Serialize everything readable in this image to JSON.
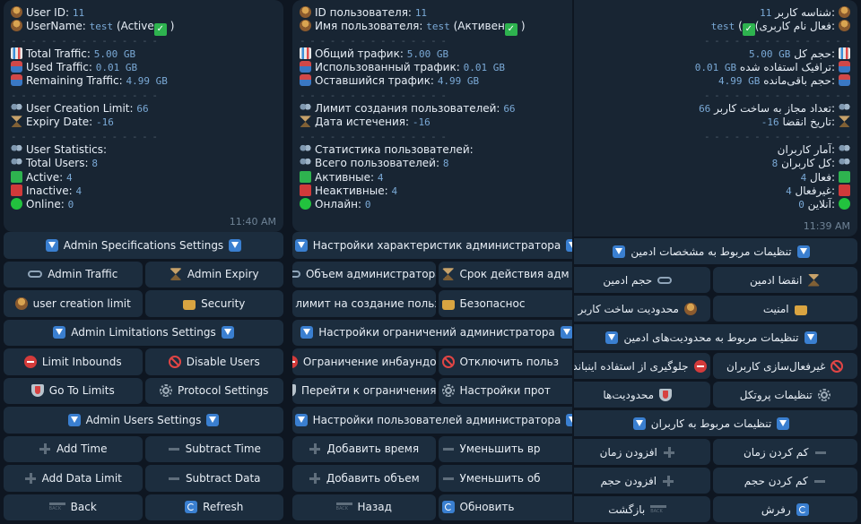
{
  "panels": [
    {
      "lines": [
        {
          "label": "User ID:",
          "value": "11"
        },
        {
          "label": "UserName:",
          "value": "test",
          "suffix": "(Active"
        },
        {
          "label": "Total Traffic:",
          "value": "5.00 GB"
        },
        {
          "label": "Used Traffic:",
          "value": "0.01 GB"
        },
        {
          "label": "Remaining Traffic:",
          "value": "4.99 GB"
        },
        {
          "label": "User Creation Limit:",
          "value": "66"
        },
        {
          "label": "Expiry Date:",
          "value": "-16"
        },
        {
          "label": "User Statistics:",
          "value": ""
        },
        {
          "label": "Total Users:",
          "value": "8"
        },
        {
          "label": "Active:",
          "value": "4"
        },
        {
          "label": "Inactive:",
          "value": "4"
        },
        {
          "label": "Online:",
          "value": "0"
        }
      ],
      "time": "11:40 AM",
      "buttons": [
        [
          "Admin Specifications Settings"
        ],
        [
          "Admin Traffic",
          "Admin Expiry"
        ],
        [
          "user creation limit",
          "Security"
        ],
        [
          "Admin Limitations Settings"
        ],
        [
          "Limit Inbounds",
          "Disable Users"
        ],
        [
          "Go To Limits",
          "Protocol Settings"
        ],
        [
          "Admin Users Settings"
        ],
        [
          "Add Time",
          "Subtract Time"
        ],
        [
          "Add Data Limit",
          "Subtract Data"
        ],
        [
          "Back",
          "Refresh"
        ]
      ]
    },
    {
      "lines": [
        {
          "label": "ID пользователя:",
          "value": "11"
        },
        {
          "label": "Имя пользователя:",
          "value": "test",
          "suffix": "(Активен"
        },
        {
          "label": "Общий трафик:",
          "value": "5.00 GB"
        },
        {
          "label": "Использованный трафик:",
          "value": "0.01 GB"
        },
        {
          "label": "Оставшийся трафик:",
          "value": "4.99 GB"
        },
        {
          "label": "Лимит создания пользователей:",
          "value": "66"
        },
        {
          "label": "Дата истечения:",
          "value": "-16"
        },
        {
          "label": "Статистика пользователей:",
          "value": ""
        },
        {
          "label": "Всего пользователей:",
          "value": "8"
        },
        {
          "label": "Активные:",
          "value": "4"
        },
        {
          "label": "Неактивные:",
          "value": "4"
        },
        {
          "label": "Онлайн:",
          "value": "0"
        }
      ],
      "buttons": [
        [
          "Настройки характеристик администратора"
        ],
        [
          "Объем администратора",
          "Срок действия адм"
        ],
        [
          "лимит на создание польз...",
          "Безопаснос"
        ],
        [
          "Настройки ограничений администратора"
        ],
        [
          "Ограничение инбаундов",
          "Отключить польз"
        ],
        [
          "Перейти к ограничениям",
          "Настройки прот"
        ],
        [
          "Настройки пользователей администратора"
        ],
        [
          "Добавить время",
          "Уменьшить вр"
        ],
        [
          "Добавить объем",
          "Уменьшить об"
        ],
        [
          "Назад",
          "Обновить"
        ]
      ]
    },
    {
      "lines": [
        {
          "label": "شناسه کاربر:",
          "value": "11"
        },
        {
          "label": "نام کاربری:",
          "value": "test",
          "suffix": "(فعال"
        },
        {
          "label": "حجم کل:",
          "value": "5.00 GB"
        },
        {
          "label": "ترافیک استفاده شده:",
          "value": "0.01 GB"
        },
        {
          "label": "حجم باقی‌مانده:",
          "value": "4.99 GB"
        },
        {
          "label": "تعداد مجاز به ساخت کاربر:",
          "value": "66"
        },
        {
          "label": "تاریخ انقضا:",
          "value": "-16"
        },
        {
          "label": "آمار کاربران:",
          "value": ""
        },
        {
          "label": "کل کاربران:",
          "value": "8"
        },
        {
          "label": "فعال:",
          "value": "4"
        },
        {
          "label": "غیرفعال:",
          "value": "4"
        },
        {
          "label": "آنلاین:",
          "value": "0"
        }
      ],
      "time": "11:39 AM",
      "buttons": [
        [
          "تنظیمات مربوط به مشخصات ادمین"
        ],
        [
          "انقضا ادمین",
          "حجم ادمین"
        ],
        [
          "امنیت",
          "محدودیت ساخت کاربر"
        ],
        [
          "تنظیمات مربوط به محدودیت‌های ادمین"
        ],
        [
          "غیرفعال‌سازی کاربران",
          "جلوگیری از استفاده اینباند"
        ],
        [
          "تنظیمات پروتکل",
          "محدودیت‌ها"
        ],
        [
          "تنظیمات مربوط به کاربران"
        ],
        [
          "کم کردن زمان",
          "افزودن زمان"
        ],
        [
          "کم کردن حجم",
          "افزودن حجم"
        ],
        [
          "رفرش",
          "بازگشت"
        ]
      ]
    }
  ],
  "separator": "- - - - - - - - - - - - - - -",
  "icons": [
    "user-icon",
    "chart-icon",
    "tray-icon",
    "users-icon",
    "hourglass-icon",
    "check-icon",
    "green-square-icon",
    "red-square-icon",
    "green-circle-icon",
    "down-arrow-icon",
    "infinity-icon",
    "lock-icon",
    "stop-icon",
    "ban-icon",
    "shield-icon",
    "gear-icon",
    "plus-icon",
    "minus-icon",
    "back-icon",
    "refresh-icon"
  ],
  "colors": {
    "bg": "#0e1621",
    "bubble": "#182533",
    "button": "#1c2d3e",
    "value": "#7aa9d6",
    "accent": "#3a7fd0"
  }
}
